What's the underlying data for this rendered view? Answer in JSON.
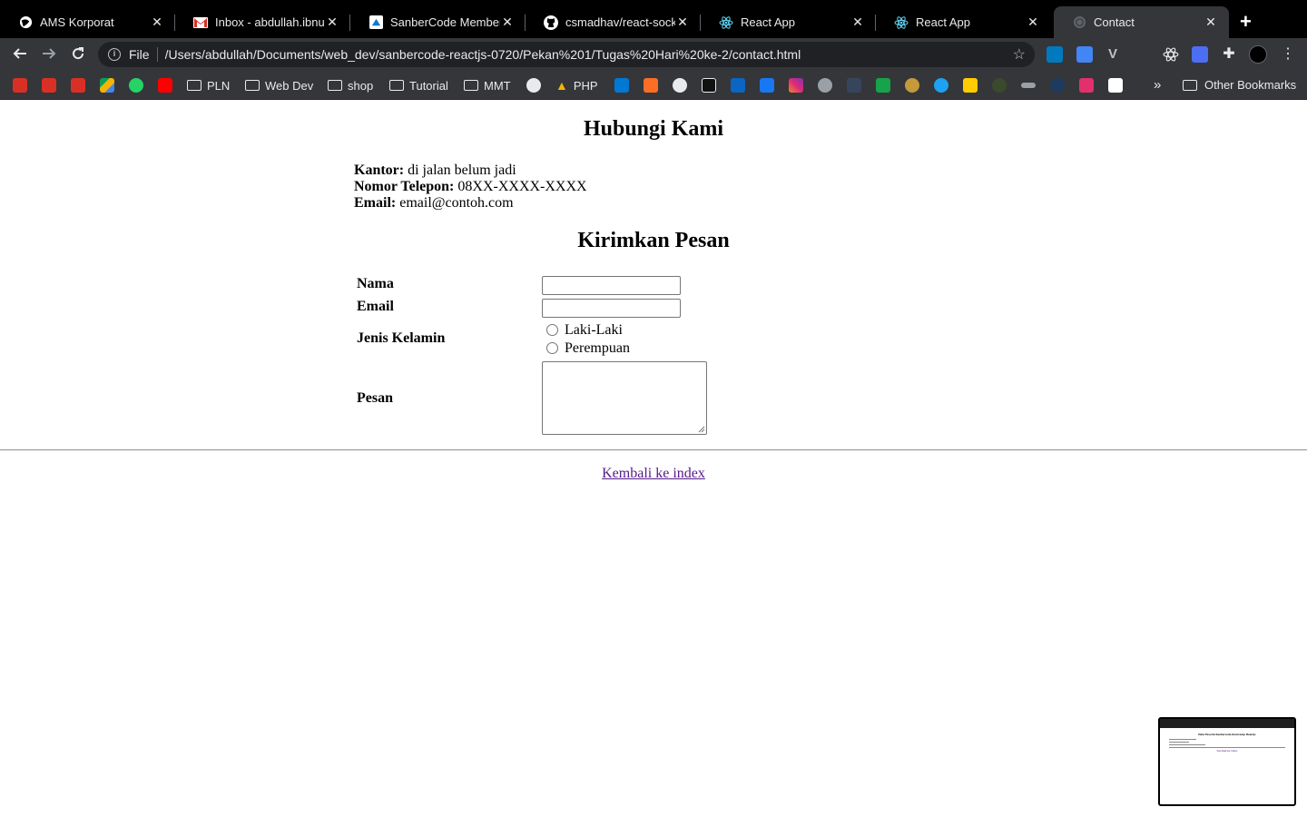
{
  "browser": {
    "tabs": [
      {
        "title": "AMS Korporat",
        "icon": "globe-icon",
        "active": false
      },
      {
        "title": "Inbox - abdullah.ibnu.h",
        "icon": "gmail-icon",
        "active": false
      },
      {
        "title": "SanberCode Member Are",
        "icon": "sanbercode-icon",
        "active": false
      },
      {
        "title": "csmadhav/react-socket",
        "icon": "github-icon",
        "active": false
      },
      {
        "title": "React App",
        "icon": "react-icon",
        "active": false
      },
      {
        "title": "React App",
        "icon": "react-icon",
        "active": false
      },
      {
        "title": "Contact",
        "icon": "globe-icon",
        "active": true
      }
    ],
    "new_tab": "+",
    "close_glyph": "✕",
    "address": {
      "scheme": "File",
      "url": "/Users/abdullah/Documents/web_dev/sanbercode-reactjs-0720/Pekan%201/Tugas%20Hari%20ke-2/contact.html"
    },
    "bookmarks": {
      "folders": [
        "PLN",
        "Web Dev",
        "shop",
        "Tutorial",
        "MMT"
      ],
      "php": "PHP",
      "other": "Other Bookmarks",
      "more": "»"
    },
    "colors": {
      "tabbar": "#000000",
      "toolbar": "#35363a",
      "omnibox": "#202124",
      "active_tab": "#35363a"
    }
  },
  "page": {
    "title": "Hubungi Kami",
    "office_label": "Kantor:",
    "office_value": " di jalan belum jadi",
    "phone_label": "Nomor Telepon:",
    "phone_value": " 08XX-XXXX-XXXX",
    "email_label": "Email:",
    "email_value": " email@contoh.com",
    "form_title": "Kirimkan Pesan",
    "form": {
      "name_label": "Nama",
      "email_label": "Email",
      "gender_label": "Jenis Kelamin",
      "gender_options": [
        "Laki-Laki",
        "Perempuan"
      ],
      "message_label": "Pesan"
    },
    "back_link": "Kembali ke index",
    "link_color": "#551a8b"
  },
  "thumbnail": {
    "title": "Data Peserta Sanbercode Bootcamp Reactjs"
  }
}
